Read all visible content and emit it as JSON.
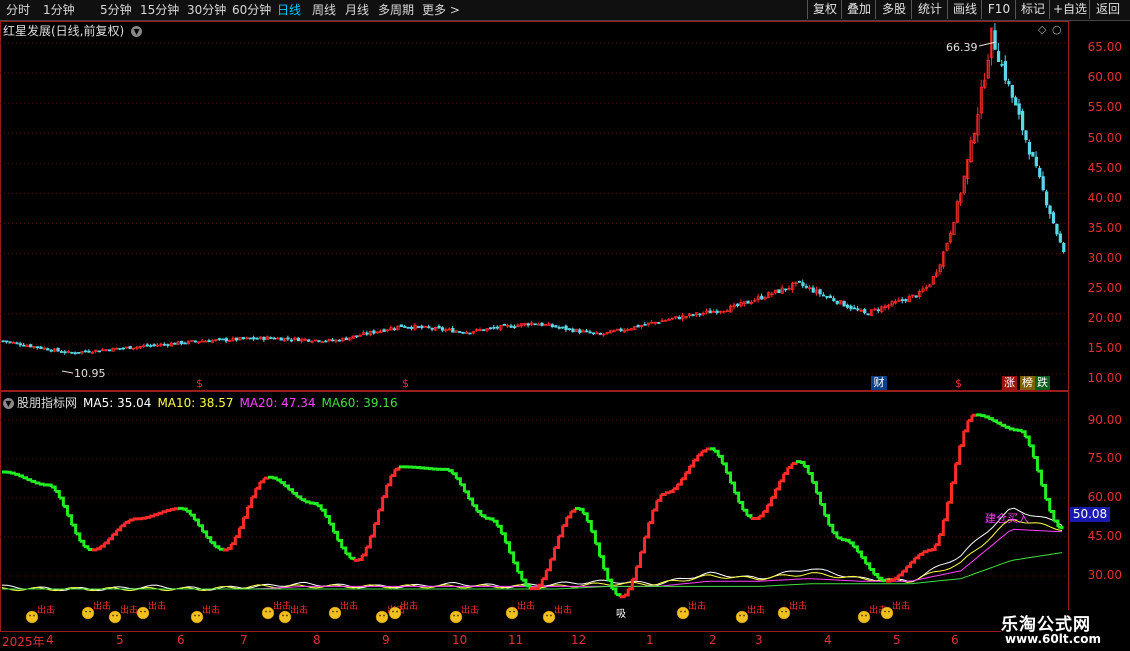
{
  "toolbar": {
    "periods": [
      "分时",
      "1分钟",
      "5分钟",
      "15分钟",
      "30分钟",
      "60分钟",
      "日线",
      "周线",
      "月线",
      "多周期",
      "更多"
    ],
    "active_period": "日线",
    "buttons": [
      "复权",
      "叠加",
      "多股",
      "统计",
      "画线",
      "F10",
      "标记",
      "+自选",
      "返回"
    ]
  },
  "main_chart": {
    "title": "红星发展(日线,前复权)",
    "price_ticks": [
      "65.00",
      "60.00",
      "55.00",
      "50.00",
      "45.00",
      "40.00",
      "35.00",
      "30.00",
      "25.00",
      "20.00",
      "15.00",
      "10.00"
    ],
    "high_label": "66.39",
    "low_label": "10.95",
    "markers": {
      "dividend": "$",
      "finance": "财",
      "limit_up": "涨",
      "ranking": "榜",
      "drop": "跌"
    }
  },
  "indicator": {
    "name": "股朋指标网",
    "ma5": "MA5: 35.04",
    "ma10": "MA10: 38.57",
    "ma20": "MA20: 47.34",
    "ma60": "MA60: 39.16",
    "current_value": "50.08",
    "ticks": [
      "90.00",
      "75.00",
      "60.00",
      "45.00",
      "30.00"
    ],
    "signal_labels": {
      "sell": "出击",
      "absorb": "吸",
      "buy_zone": "建仓买入"
    }
  },
  "time_axis": {
    "months": [
      "2025年",
      "4",
      "5",
      "6",
      "7",
      "8",
      "9",
      "10",
      "11",
      "12",
      "1",
      "2",
      "3",
      "4",
      "5",
      "6"
    ]
  },
  "watermark": {
    "title": "乐淘公式网",
    "url": "www.60lt.com"
  },
  "colors": {
    "up": "#ff2a2a",
    "down": "#22ee22",
    "flat": "#5ad8e8",
    "axis": "#9b1c1c",
    "ma5": "#ffffff",
    "ma10": "#ffff40",
    "ma20": "#ff40ff",
    "ma60": "#40e040",
    "active": "#00c8ff"
  },
  "chart_data": [
    {
      "type": "candlestick",
      "title": "红星发展(日线,前复权)",
      "ylim": [
        8,
        68
      ],
      "x": [
        "2025-03",
        "2025-04",
        "2025-05",
        "2025-06",
        "2025-07",
        "2025-08",
        "2025-09",
        "2025-10",
        "2025-11",
        "2025-12",
        "2026-01",
        "2026-02",
        "2026-03",
        "2026-04",
        "2026-05",
        "2026-06"
      ],
      "close": [
        15.5,
        13.5,
        14.5,
        15.5,
        16.0,
        15.5,
        18.0,
        17.0,
        18.5,
        16.5,
        19.0,
        21.0,
        25.0,
        20.0,
        24.0,
        50.0,
        30.0
      ],
      "high_point": 66.39,
      "low_point": 10.95
    },
    {
      "type": "line",
      "title": "股朋指标网",
      "ylim": [
        22,
        98
      ],
      "series": [
        {
          "name": "指标",
          "values": [
            70,
            65,
            40,
            52,
            56,
            40,
            68,
            58,
            36,
            72,
            71,
            52,
            25,
            56,
            22,
            62,
            79,
            52,
            74,
            44,
            28,
            40,
            92,
            86,
            48
          ]
        },
        {
          "name": "MA5",
          "values": [
            26,
            25,
            25,
            26,
            25,
            26,
            27,
            26,
            26,
            27,
            26,
            27,
            28,
            27,
            31,
            29,
            33,
            29,
            28,
            38,
            56,
            50
          ]
        },
        {
          "name": "MA10",
          "values": [
            25,
            25,
            25,
            25,
            25,
            26,
            26,
            26,
            26,
            26,
            26,
            26,
            27,
            27,
            30,
            29,
            31,
            29,
            28,
            35,
            52,
            48
          ]
        },
        {
          "name": "MA20",
          "values": [
            25,
            25,
            25,
            25,
            25,
            25,
            26,
            26,
            26,
            26,
            26,
            26,
            26,
            26,
            28,
            28,
            29,
            28,
            28,
            32,
            48,
            47
          ]
        },
        {
          "name": "MA60",
          "values": [
            25,
            25,
            25,
            25,
            25,
            25,
            25,
            25,
            25,
            25,
            25,
            25,
            26,
            26,
            26,
            26,
            27,
            27,
            27,
            29,
            36,
            39
          ]
        }
      ],
      "ma5": 35.04,
      "ma10": 38.57,
      "ma20": 47.34,
      "ma60": 39.16,
      "current": 50.08
    }
  ]
}
